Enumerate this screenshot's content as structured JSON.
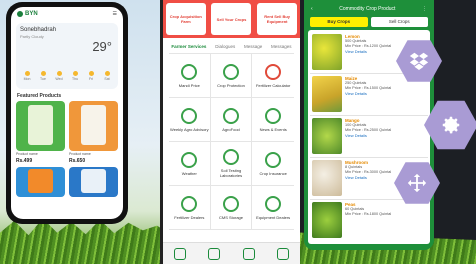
{
  "colors": {
    "accent_red": "#f04e45",
    "accent_green": "#1e8f3a",
    "hex_purple": "#a99bd4"
  },
  "phone1": {
    "brand": "BYN",
    "weather": {
      "location": "Sonebhadrah",
      "subtitle": "Partly Cloudy",
      "temperature": "29°",
      "days": [
        "Mon",
        "Tue",
        "Wed",
        "Thu",
        "Fri",
        "Sat"
      ]
    },
    "section_title": "Featured Products",
    "products": [
      {
        "info": "Product name",
        "price": "Rs.499"
      },
      {
        "info": "Product name",
        "price": "Rs.650"
      }
    ]
  },
  "phone2": {
    "top_buttons": [
      "Crop Acquisition Farm",
      "Sell Your Crops",
      "Rent Sell Buy Equipment"
    ],
    "tabs": [
      "Farmer Services",
      "Dialogues",
      "Message",
      "Messages"
    ],
    "grid": [
      "Mandi Price",
      "Crop Protection",
      "Fertilizer Calculator",
      "Weekly Agro Advisory",
      "AgroFood",
      "News & Events",
      "Weather",
      "Soil Testing Laboratories",
      "Crop Insurance",
      "Fertilizer Dealers",
      "CMS Storage",
      "Equipment Dealers"
    ]
  },
  "phone3": {
    "header": "Commodity Crop Product",
    "tabs": [
      "Buy Crops",
      "Sell Crops"
    ],
    "items": [
      {
        "name": "Lemon",
        "qty": "500 Quintals",
        "price": "Min Price : Rs.1200 Quintal",
        "link": "View Details"
      },
      {
        "name": "Maize",
        "qty": "250 Quintals",
        "price": "Min Price : Rs.1500 Quintal",
        "link": "View Details"
      },
      {
        "name": "Mango",
        "qty": "100 Quintals",
        "price": "Min Price : Rs.2500 Quintal",
        "link": "View Details"
      },
      {
        "name": "Mushroom",
        "qty": "8 Quintals",
        "price": "Min Price : Rs.3000 Quintal",
        "link": "View Details"
      },
      {
        "name": "Peas",
        "qty": "60 Quintals",
        "price": "Min Price : Rs.1800 Quintal",
        "link": "View Details"
      }
    ]
  },
  "hex_buttons": [
    "dropbox-icon",
    "settings-icon",
    "move-icon"
  ]
}
